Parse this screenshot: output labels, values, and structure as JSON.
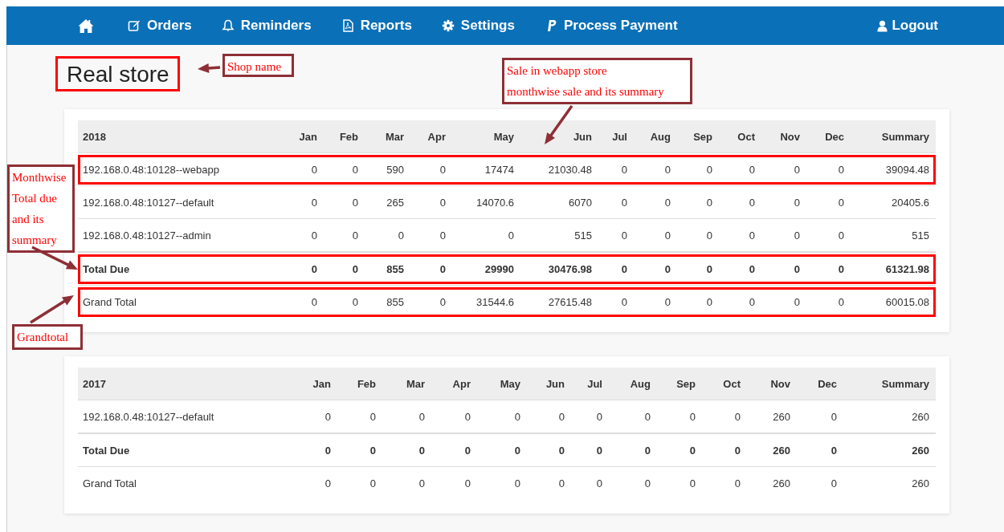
{
  "nav": {
    "items": [
      {
        "kind": "home"
      },
      {
        "kind": "edit",
        "label": "Orders"
      },
      {
        "kind": "bell",
        "label": "Reminders"
      },
      {
        "kind": "file",
        "label": "Reports"
      },
      {
        "kind": "gear",
        "label": "Settings"
      },
      {
        "kind": "paypal",
        "label": "Process Payment"
      }
    ],
    "logout": {
      "kind": "user",
      "label": "Logout"
    }
  },
  "title": {
    "text": "Real store",
    "highlighted": true
  },
  "tables": [
    {
      "columns": [
        "2018",
        "Jan",
        "Feb",
        "Mar",
        "Apr",
        "May",
        "Jun",
        "Jul",
        "Aug",
        "Sep",
        "Oct",
        "Nov",
        "Dec",
        "Summary"
      ],
      "rows": [
        {
          "kind": "store",
          "highlighted": true,
          "cells": [
            "192.168.0.48:10128--webapp",
            "0",
            "0",
            "590",
            "0",
            "17474",
            "21030.48",
            "0",
            "0",
            "0",
            "0",
            "0",
            "0",
            "39094.48"
          ]
        },
        {
          "kind": "store",
          "highlighted": false,
          "cells": [
            "192.168.0.48:10127--default",
            "0",
            "0",
            "265",
            "0",
            "14070.6",
            "6070",
            "0",
            "0",
            "0",
            "0",
            "0",
            "0",
            "20405.6"
          ]
        },
        {
          "kind": "store",
          "highlighted": false,
          "cells": [
            "192.168.0.48:10127--admin",
            "0",
            "0",
            "0",
            "0",
            "0",
            "515",
            "0",
            "0",
            "0",
            "0",
            "0",
            "0",
            "515"
          ]
        },
        {
          "kind": "total",
          "highlighted": true,
          "cells": [
            "Total Due",
            "0",
            "0",
            "855",
            "0",
            "29990",
            "30476.98",
            "0",
            "0",
            "0",
            "0",
            "0",
            "0",
            "61321.98"
          ]
        },
        {
          "kind": "grand",
          "highlighted": true,
          "cells": [
            "Grand Total",
            "0",
            "0",
            "855",
            "0",
            "31544.6",
            "27615.48",
            "0",
            "0",
            "0",
            "0",
            "0",
            "0",
            "60015.08"
          ]
        }
      ]
    },
    {
      "columns": [
        "2017",
        "Jan",
        "Feb",
        "Mar",
        "Apr",
        "May",
        "Jun",
        "Jul",
        "Aug",
        "Sep",
        "Oct",
        "Nov",
        "Dec",
        "Summary"
      ],
      "rows": [
        {
          "kind": "store",
          "highlighted": false,
          "cells": [
            "192.168.0.48:10127--default",
            "0",
            "0",
            "0",
            "0",
            "0",
            "0",
            "0",
            "0",
            "0",
            "0",
            "260",
            "0",
            "260"
          ]
        },
        {
          "kind": "total",
          "highlighted": false,
          "cells": [
            "Total Due",
            "0",
            "0",
            "0",
            "0",
            "0",
            "0",
            "0",
            "0",
            "0",
            "0",
            "260",
            "0",
            "260"
          ]
        },
        {
          "kind": "grand",
          "highlighted": false,
          "cells": [
            "Grand Total",
            "0",
            "0",
            "0",
            "0",
            "0",
            "0",
            "0",
            "0",
            "0",
            "0",
            "260",
            "0",
            "260"
          ]
        }
      ]
    }
  ],
  "annotations": [
    {
      "lines": [
        "Shop name"
      ]
    },
    {
      "lines": [
        "Sale in webapp store",
        "monthwise sale and its summary"
      ]
    },
    {
      "lines": [
        "Monthwise",
        "Total due",
        "and its",
        "summary"
      ]
    },
    {
      "lines": [
        "Grandtotal"
      ]
    }
  ]
}
